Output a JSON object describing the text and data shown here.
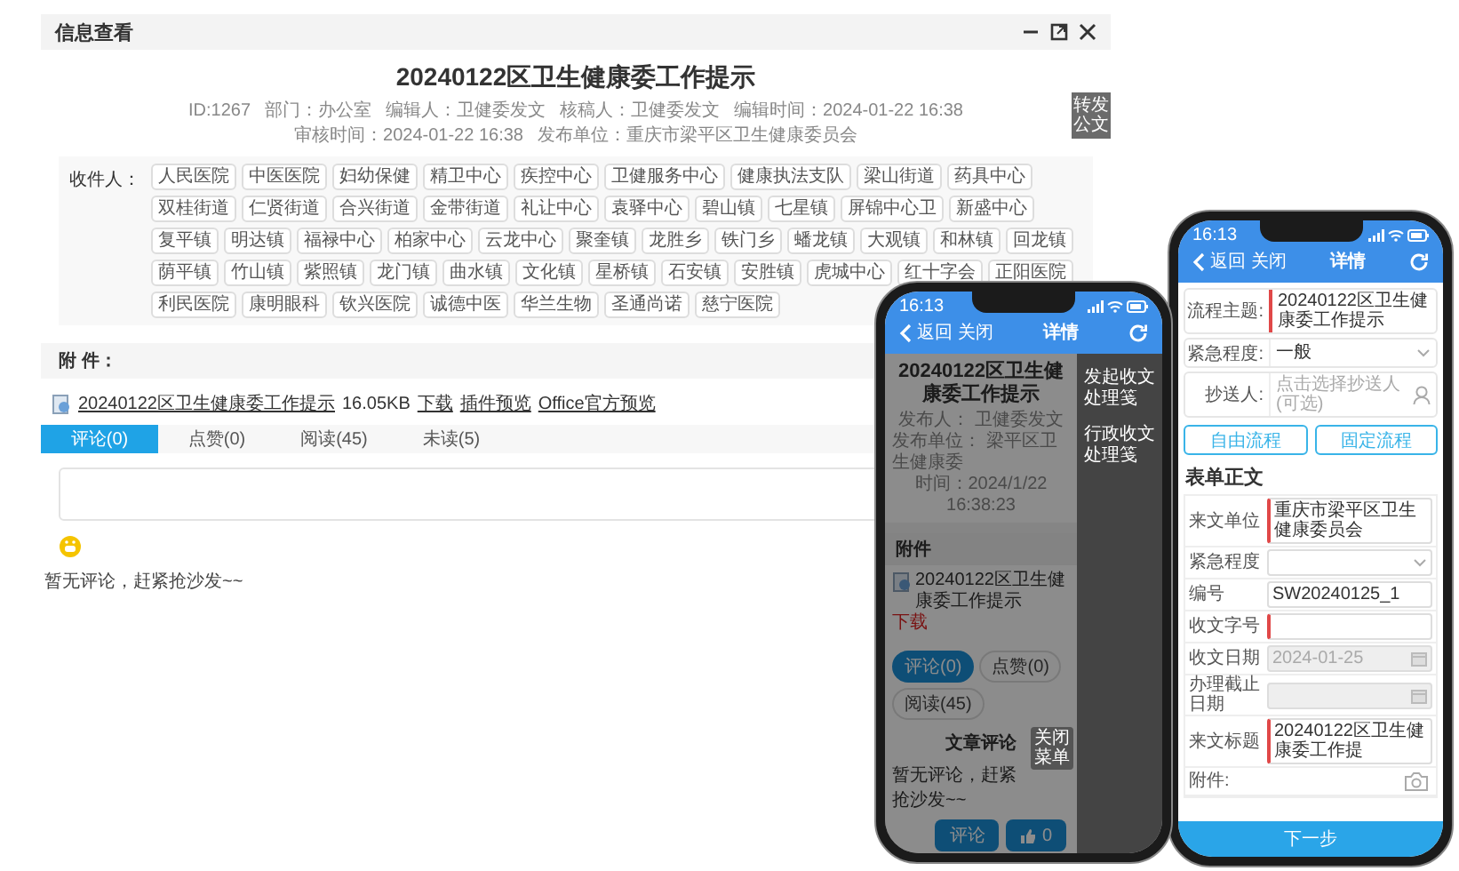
{
  "window": {
    "title": "信息查看"
  },
  "article": {
    "title": "20240122区卫生健康委工作提示",
    "meta": [
      "ID:1267",
      "部门：办公室",
      "编辑人：卫健委发文",
      "核稿人：卫健委发文",
      "编辑时间：2024-01-22 16:38",
      "审核时间：2024-01-22 16:38",
      "发布单位：重庆市梁平区卫生健康委员会"
    ]
  },
  "side_tab": {
    "label": "转发公文"
  },
  "recipients": {
    "label": "收件人：",
    "tags": [
      "人民医院",
      "中医医院",
      "妇幼保健",
      "精卫中心",
      "疾控中心",
      "卫健服务中心",
      "健康执法支队",
      "梁山街道",
      "药具中心",
      "双桂街道",
      "仁贤街道",
      "合兴街道",
      "金带街道",
      "礼让中心",
      "袁驿中心",
      "碧山镇",
      "七星镇",
      "屏锦中心卫",
      "新盛中心",
      "复平镇",
      "明达镇",
      "福禄中心",
      "柏家中心",
      "云龙中心",
      "聚奎镇",
      "龙胜乡",
      "铁门乡",
      "蟠龙镇",
      "大观镇",
      "和林镇",
      "回龙镇",
      "荫平镇",
      "竹山镇",
      "紫照镇",
      "龙门镇",
      "曲水镇",
      "文化镇",
      "星桥镇",
      "石安镇",
      "安胜镇",
      "虎城中心",
      "红十字会",
      "正阳医院",
      "利民医院",
      "康明眼科",
      "钦兴医院",
      "诚德中医",
      "华兰生物",
      "圣通尚诺",
      "慈宁医院"
    ]
  },
  "attachments": {
    "heading": "附 件：",
    "file": {
      "name": "20240122区卫生健康委工作提示",
      "size": "16.05KB",
      "actions": [
        "下载",
        "插件预览",
        "Office官方预览"
      ]
    }
  },
  "tabs": [
    {
      "label": "评论(0)",
      "selected": true
    },
    {
      "label": "点赞(0)",
      "selected": false
    },
    {
      "label": "阅读(45)",
      "selected": false
    },
    {
      "label": "未读(5)",
      "selected": false
    }
  ],
  "empty_comments": "暂无评论，赶紧抢沙发~~",
  "phone_detail": {
    "status_time": "16:13",
    "nav": {
      "back": "返回",
      "close": "关闭",
      "title": "详情"
    },
    "article": {
      "title": "20240122区卫生健康委工作提示",
      "meta": [
        "发布人： 卫健委发文",
        "发布单位： 梁平区卫生健康委"
      ],
      "time": "时间：2024/1/22 16:38:23"
    },
    "attachment_heading": "附件",
    "attachment": {
      "name": "20240122区卫生健康委工作提示",
      "action": "下载"
    },
    "tabs": [
      {
        "label": "评论(0)",
        "selected": true
      },
      {
        "label": "点赞(0)",
        "selected": false
      },
      {
        "label": "阅读(45)",
        "selected": false
      }
    ],
    "comments_heading": "文章评论",
    "empty_comments": "暂无评论，赶紧抢沙发~~",
    "comment_button": "评论",
    "like_count": "0",
    "drawer": {
      "items": [
        "发起收文处理笺",
        "行政收文处理笺"
      ]
    },
    "tooltip": "关闭菜单"
  },
  "phone_form": {
    "status_time": "16:13",
    "nav": {
      "back": "返回",
      "close": "关闭",
      "title": "详情"
    },
    "fields": [
      {
        "kind": "text",
        "label": "流程主题:",
        "value": "20240122区卫生健康委工作提示",
        "required": true
      },
      {
        "kind": "select",
        "label": "紧急程度:",
        "value": "一般",
        "required": false
      },
      {
        "kind": "person",
        "label": "抄送人:",
        "placeholder": "点击选择抄送人(可选)",
        "required": false
      }
    ],
    "flow_buttons": [
      "自由流程",
      "固定流程"
    ],
    "section_title": "表单正文",
    "rows": [
      {
        "kind": "text",
        "label": "来文单位",
        "value": "重庆市梁平区卫生健康委员会",
        "required": true,
        "disabled": false
      },
      {
        "kind": "select",
        "label": "紧急程度",
        "required": false,
        "disabled": false
      },
      {
        "kind": "text",
        "label": "编号",
        "value": "SW20240125_1",
        "required": false,
        "disabled": false
      },
      {
        "kind": "text",
        "label": "收文字号",
        "required": true,
        "disabled": false
      },
      {
        "kind": "date",
        "label": "收文日期",
        "value": "2024-01-25",
        "required": false,
        "disabled": true
      },
      {
        "kind": "date",
        "label": "办理截止日期",
        "required": false,
        "disabled": true
      },
      {
        "kind": "text",
        "label": "来文标题",
        "value": "20240122区卫生健康委工作提",
        "required": true,
        "disabled": false
      },
      {
        "kind": "camera",
        "label": "附件:",
        "disabled": false
      }
    ],
    "next_button": "下一步"
  }
}
